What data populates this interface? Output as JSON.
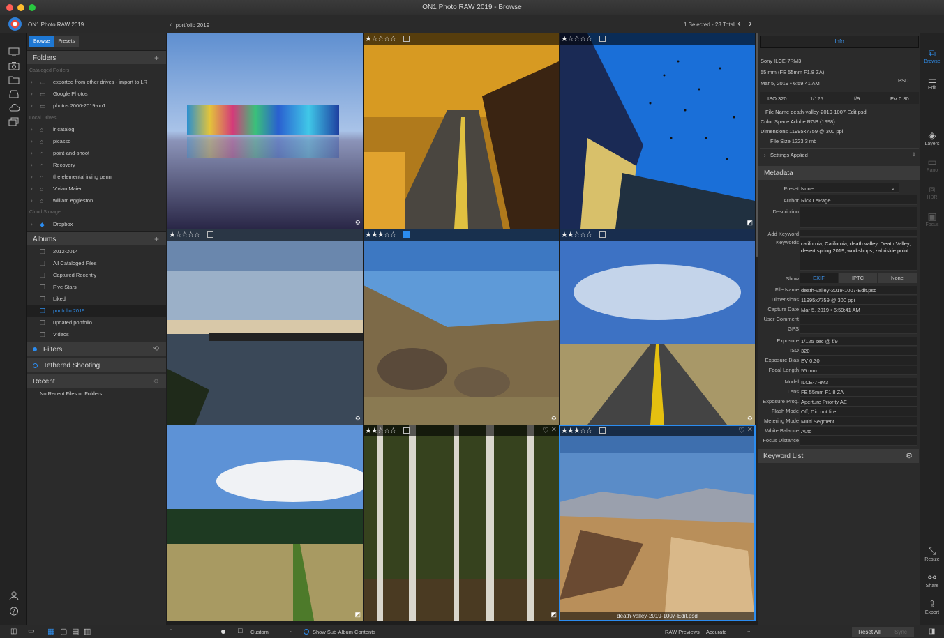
{
  "window": {
    "title": "ON1 Photo RAW 2019 - Browse"
  },
  "appbar": {
    "app_name": "ON1 Photo RAW 2019",
    "breadcrumb_arrow": "‹",
    "breadcrumb": "portfolio 2019",
    "selection_count": "1 Selected - 23 Total",
    "prev": "‹",
    "next": "›"
  },
  "left_panel": {
    "tabs": {
      "browse": "Browse",
      "presets": "Presets"
    },
    "folders": {
      "title": "Folders",
      "add": "+",
      "cataloged_header": "Cataloged Folders",
      "cataloged": [
        "exported from other drives - import to LR",
        "Google Photos",
        "photos 2000-2019-on1"
      ],
      "local_header": "Local Drives",
      "local": [
        "lr catalog",
        "picasso",
        "point-and-shoot",
        "Recovery",
        "the elemental irving penn",
        "Vivian Maier",
        "william eggleston"
      ],
      "cloud_header": "Cloud Storage",
      "cloud": [
        "Dropbox"
      ]
    },
    "albums": {
      "title": "Albums",
      "add": "+",
      "items": [
        "2012-2014",
        "All Cataloged Files",
        "Captured Recently",
        "Five Stars",
        "Liked",
        "portfolio 2019",
        "updated portfolio",
        "Videos"
      ],
      "selected": "portfolio 2019"
    },
    "filters": {
      "title": "Filters",
      "reset": "⟲"
    },
    "tethered": {
      "title": "Tethered Shooting"
    },
    "recent": {
      "title": "Recent",
      "empty": "No Recent Files or Folders"
    }
  },
  "grid": {
    "cells": [
      {
        "stars": "",
        "flag": "none",
        "heart": false,
        "caption": ""
      },
      {
        "stars": "★☆☆☆☆",
        "flag": "empty",
        "heart": false,
        "caption": ""
      },
      {
        "stars": "★☆☆☆☆",
        "flag": "empty",
        "heart": false,
        "caption": ""
      },
      {
        "stars": "★☆☆☆☆",
        "flag": "empty",
        "heart": false,
        "caption": ""
      },
      {
        "stars": "★★★☆☆",
        "flag": "blue",
        "heart": false,
        "caption": ""
      },
      {
        "stars": "★★☆☆☆",
        "flag": "empty",
        "heart": false,
        "caption": ""
      },
      {
        "stars": "",
        "flag": "none",
        "heart": false,
        "caption": ""
      },
      {
        "stars": "★★☆☆☆",
        "flag": "empty",
        "heart": true,
        "caption": ""
      },
      {
        "stars": "★★★☆☆",
        "flag": "empty",
        "heart": true,
        "caption": "death-valley-2019-1007-Edit.psd"
      }
    ],
    "selected_index": 8
  },
  "info": {
    "tab": "Info",
    "camera": "Sony ILCE-7RM3",
    "lens": "55 mm (FE 55mm F1.8 ZA)",
    "date": "Mar 5, 2019 • 6:59:41 AM",
    "type": "PSD",
    "iso": "ISO 320",
    "shutter": "1/125",
    "aperture": "f/9",
    "ev": "EV 0.30",
    "file_name": "File Name death-valley-2019-1007-Edit.psd",
    "color_space": "Color Space Adobe RGB (1998)",
    "dimensions": "Dimensions 11995x7759 @ 300 ppi",
    "file_size": "File Size 1223.3 mb",
    "settings_applied": "Settings Applied"
  },
  "metadata": {
    "title": "Metadata",
    "preset_label": "Preset",
    "preset_value": "None",
    "author_label": "Author",
    "author_value": "Rick LePage",
    "description_label": "Description",
    "add_keyword_label": "Add Keyword",
    "keywords_label": "Keywords",
    "keywords_value": "california, California, death valley, Death Valley, desert spring 2019, workshops, zabriskie point",
    "show_label": "Show",
    "show_options": [
      "EXIF",
      "IPTC",
      "None"
    ],
    "show_selected": "EXIF",
    "exif": [
      {
        "k": "File Name",
        "v": "death-valley-2019-1007-Edit.psd"
      },
      {
        "k": "Dimensions",
        "v": "11995x7759 @ 300 ppi"
      },
      {
        "k": "Capture Date",
        "v": "Mar 5, 2019 • 6:59:41 AM"
      },
      {
        "k": "User Comment",
        "v": ""
      },
      {
        "k": "GPS",
        "v": ""
      },
      {
        "k": "Exposure",
        "v": "1/125 sec @ f/9"
      },
      {
        "k": "ISO",
        "v": "320"
      },
      {
        "k": "Exposure Bias",
        "v": "EV 0.30"
      },
      {
        "k": "Focal Length",
        "v": "55 mm"
      },
      {
        "k": "Model",
        "v": "ILCE-7RM3"
      },
      {
        "k": "Lens",
        "v": "FE 55mm F1.8 ZA"
      },
      {
        "k": "Exposure Prog.",
        "v": "Aperture Priority AE"
      },
      {
        "k": "Flash Mode",
        "v": "Off, Did not fire"
      },
      {
        "k": "Metering Mode",
        "v": "Multi Segment"
      },
      {
        "k": "White Balance",
        "v": "Auto"
      },
      {
        "k": "Focus Distance",
        "v": ""
      }
    ],
    "keyword_list_title": "Keyword List"
  },
  "right_rail": {
    "browse": "Browse",
    "edit": "Edit",
    "layers": "Layers",
    "pano": "Pano",
    "hdr": "HDR",
    "focus": "Focus",
    "resize": "Resize",
    "share": "Share",
    "export": "Export"
  },
  "bottom_bar": {
    "thumb_size_mode": "Custom",
    "show_sub_album": "Show Sub-Album Contents",
    "raw_previews_label": "RAW Previews",
    "raw_previews_value": "Accurate",
    "reset_all": "Reset All",
    "sync": "Sync"
  },
  "colors": {
    "accent": "#2b8cf0",
    "panel": "#2b2b2b",
    "header": "#3a3a3a"
  }
}
